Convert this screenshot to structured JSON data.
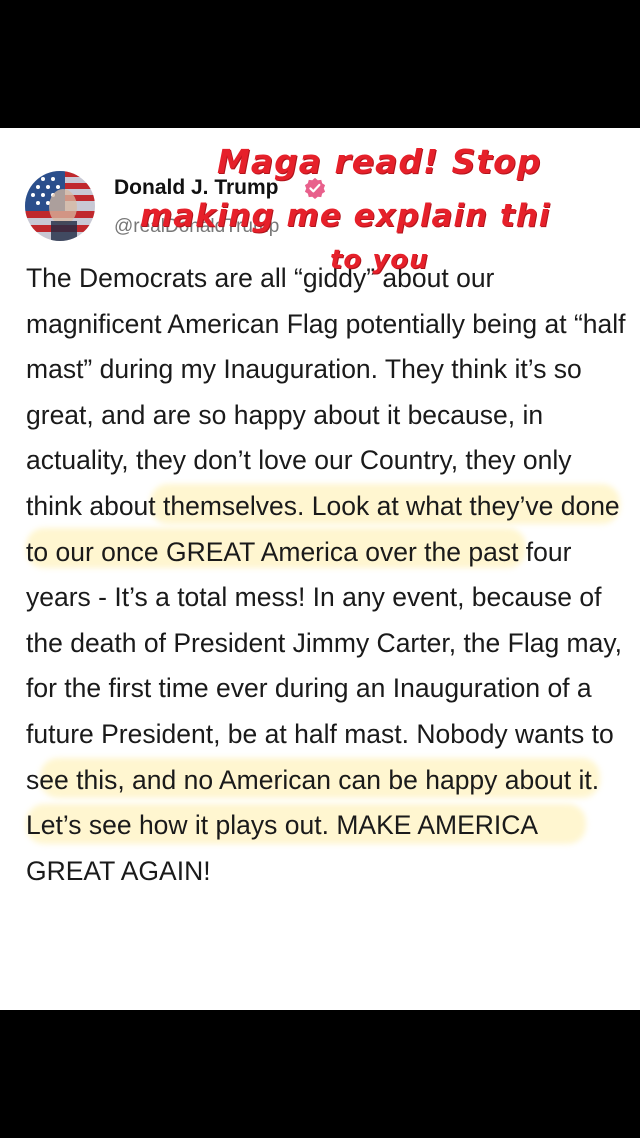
{
  "post": {
    "author_name": "Donald J. Trump",
    "handle": "@realDonaldTrump",
    "body": "The Democrats are all “giddy” about our magnificent American Flag potentially being at “half mast” during my Inauguration. They think it’s so great, and are so happy about it because, in actuality, they don’t love our Country, they only think about themselves. Look at what they’ve done to our once GREAT America over the past four years - It’s a total mess! In any event, because of the death of President Jimmy Carter, the Flag may, for the first time ever during an Inauguration of a future President, be at half mast. Nobody wants to see this, and no American can be happy about it. Let’s see how it plays out. MAKE AMERICA GREAT AGAIN!"
  },
  "overlay": {
    "line1": "Maga read! Stop",
    "line2": "making me explain thi",
    "line3": "to you"
  },
  "icons": {
    "avatar": "flag-portrait-avatar",
    "verified": "verified-badge-icon"
  },
  "colors": {
    "overlay_text": "#e6202a",
    "verified_badge": "#e8608c",
    "highlight": "#ffec96"
  }
}
